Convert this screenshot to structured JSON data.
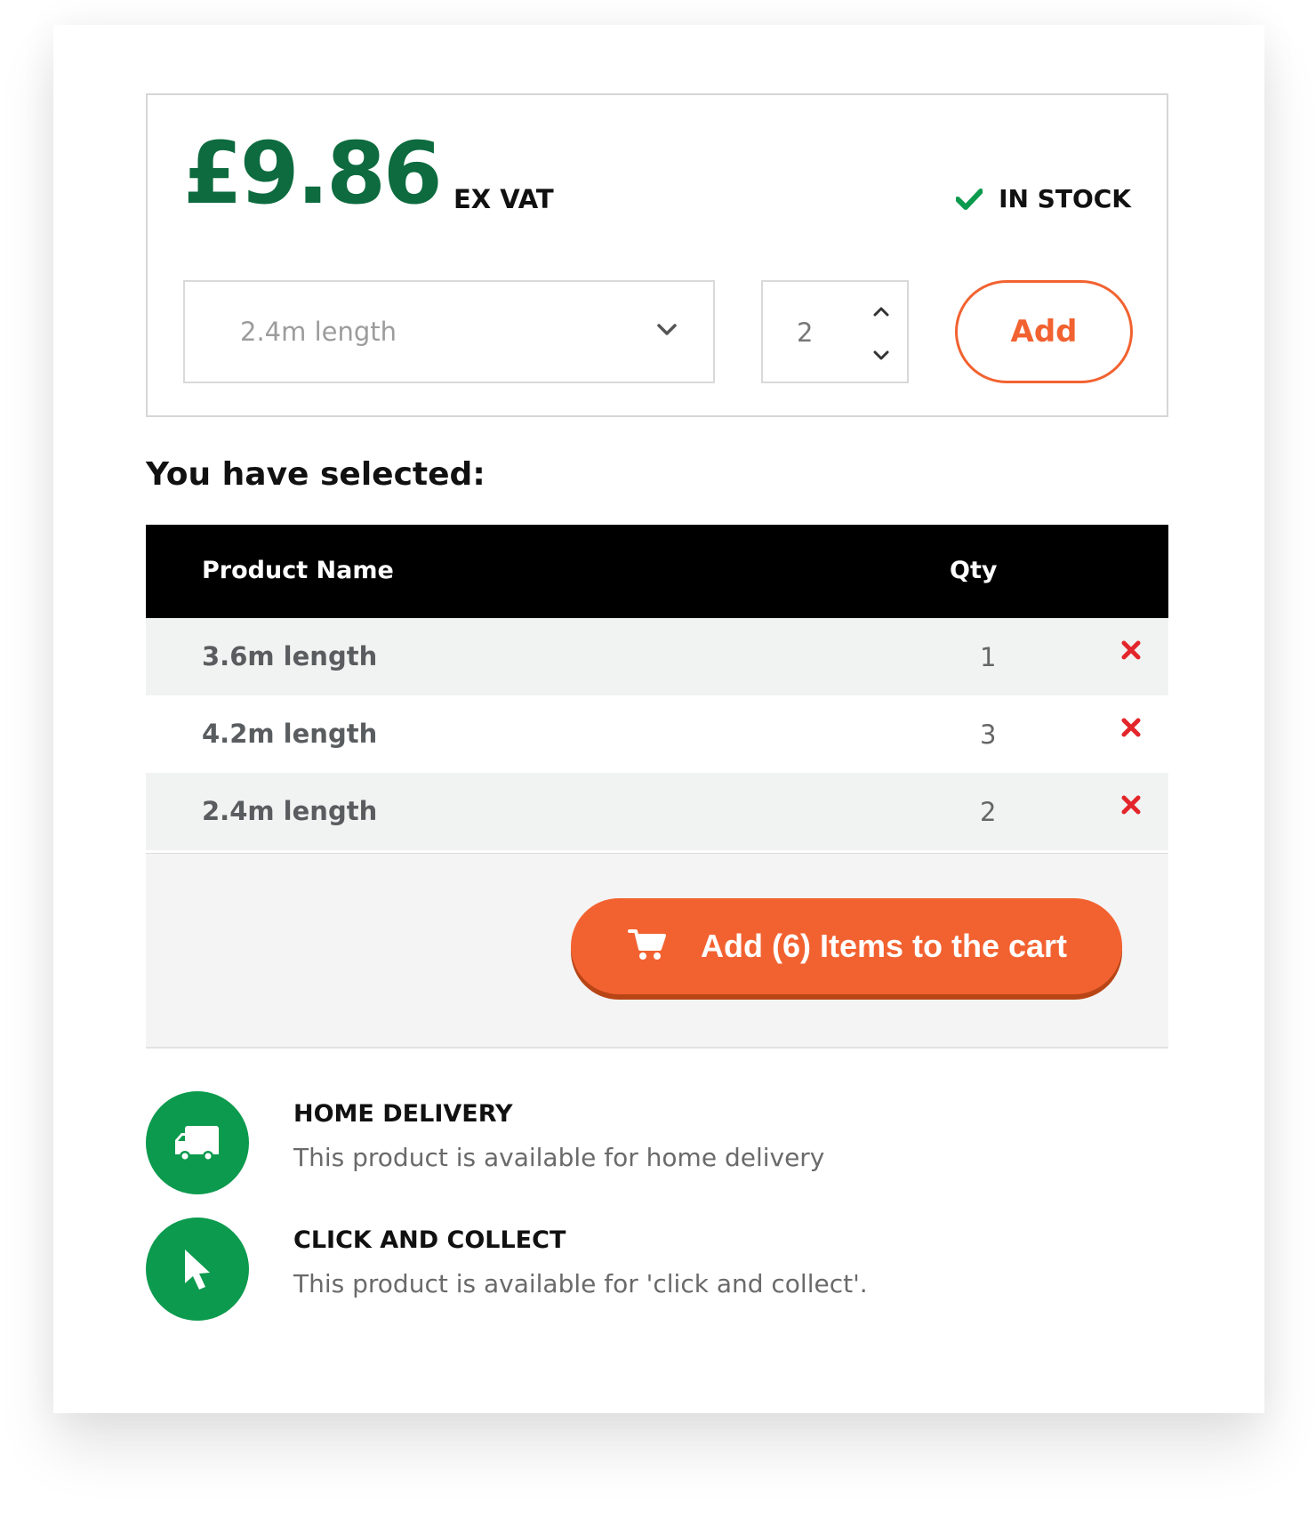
{
  "product": {
    "price": "£9.86",
    "vat_label": "EX VAT",
    "stock_status": "IN STOCK",
    "variant_select": {
      "value": "2.4m length"
    },
    "quantity": "2",
    "add_label": "Add"
  },
  "selection": {
    "title": "You have selected:",
    "columns": {
      "name": "Product Name",
      "qty": "Qty"
    },
    "rows": [
      {
        "name": "3.6m length",
        "qty": "1"
      },
      {
        "name": "4.2m length",
        "qty": "3"
      },
      {
        "name": "2.4m length",
        "qty": "2"
      }
    ],
    "cart_button_label": "Add (6) Items to the cart"
  },
  "features": [
    {
      "title": "HOME DELIVERY",
      "description": "This product is available for home delivery",
      "icon": "truck-icon"
    },
    {
      "title": "CLICK AND COLLECT",
      "description": "This product is available for 'click and collect'.",
      "icon": "cursor-icon"
    }
  ],
  "colors": {
    "brand_green": "#0d6b3f",
    "feature_green": "#0c9a4e",
    "accent_orange": "#f26230",
    "remove_red": "#e3262b"
  }
}
